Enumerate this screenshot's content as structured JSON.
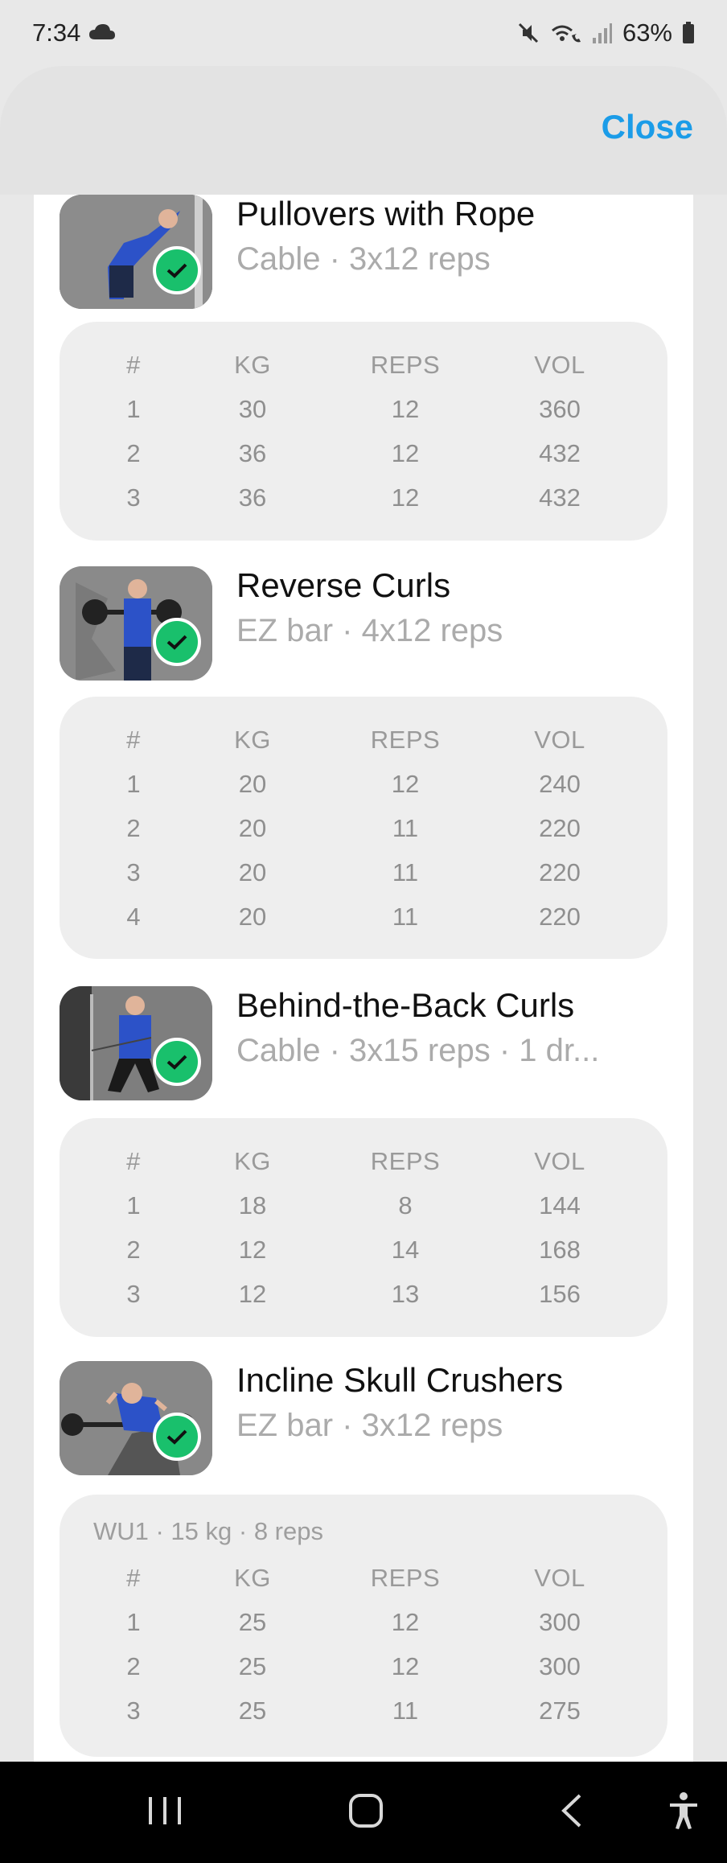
{
  "status": {
    "time": "7:34",
    "battery": "63%"
  },
  "header": {
    "close_label": "Close"
  },
  "table_headers": [
    "#",
    "KG",
    "REPS",
    "VOL"
  ],
  "exercises": [
    {
      "name": "Pullovers with Rope",
      "subtitle": "Cable · 3x12 reps",
      "completed": true,
      "warmup": "",
      "sets": [
        {
          "n": "1",
          "kg": "30",
          "reps": "12",
          "vol": "360"
        },
        {
          "n": "2",
          "kg": "36",
          "reps": "12",
          "vol": "432"
        },
        {
          "n": "3",
          "kg": "36",
          "reps": "12",
          "vol": "432"
        }
      ]
    },
    {
      "name": "Reverse Curls",
      "subtitle": "EZ bar · 4x12 reps",
      "completed": true,
      "warmup": "",
      "sets": [
        {
          "n": "1",
          "kg": "20",
          "reps": "12",
          "vol": "240"
        },
        {
          "n": "2",
          "kg": "20",
          "reps": "11",
          "vol": "220"
        },
        {
          "n": "3",
          "kg": "20",
          "reps": "11",
          "vol": "220"
        },
        {
          "n": "4",
          "kg": "20",
          "reps": "11",
          "vol": "220"
        }
      ]
    },
    {
      "name": "Behind-the-Back Curls",
      "subtitle": "Cable · 3x15 reps · 1 dr...",
      "completed": true,
      "warmup": "",
      "sets": [
        {
          "n": "1",
          "kg": "18",
          "reps": "8",
          "vol": "144"
        },
        {
          "n": "2",
          "kg": "12",
          "reps": "14",
          "vol": "168"
        },
        {
          "n": "3",
          "kg": "12",
          "reps": "13",
          "vol": "156"
        }
      ]
    },
    {
      "name": "Incline Skull Crushers",
      "subtitle": "EZ bar · 3x12 reps",
      "completed": true,
      "warmup": "WU1 · 15 kg · 8 reps",
      "sets": [
        {
          "n": "1",
          "kg": "25",
          "reps": "12",
          "vol": "300"
        },
        {
          "n": "2",
          "kg": "25",
          "reps": "12",
          "vol": "300"
        },
        {
          "n": "3",
          "kg": "25",
          "reps": "11",
          "vol": "275"
        }
      ]
    }
  ],
  "colors": {
    "accent": "#1b9ce8",
    "check": "#19c06c"
  }
}
